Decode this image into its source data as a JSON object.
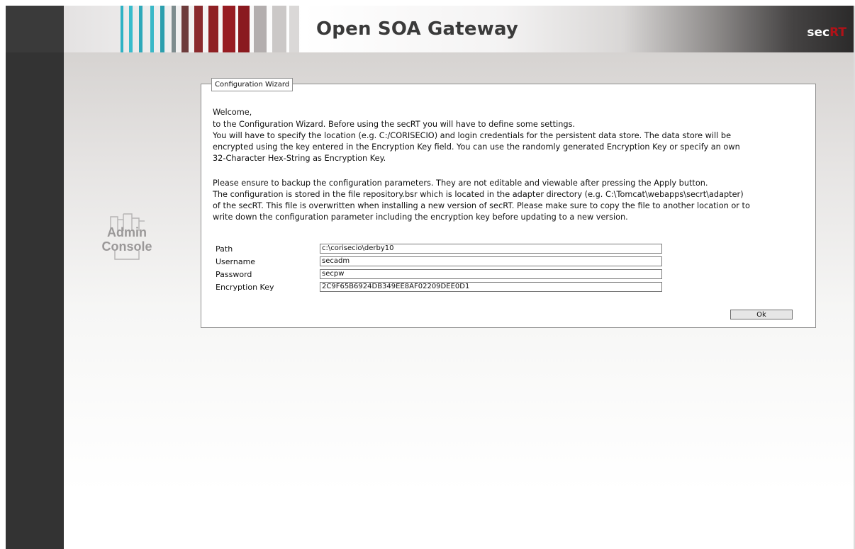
{
  "header": {
    "title": "Open SOA Gateway",
    "brand_prefix": "sec",
    "brand_suffix": "RT",
    "brand_colors": {
      "prefix": "#ffffff",
      "suffix": "#b01218"
    }
  },
  "sidebar": {
    "logo_line1": "Admin",
    "logo_line2": "Console"
  },
  "wizard": {
    "legend": "Configuration Wizard",
    "welcome": "Welcome,",
    "intro": "to the Configuration Wizard. Before using the secRT you will have to define some settings.",
    "para1_line1": "You will have to specify the location (e.g. C:/CORISECIO) and login credentials for the persistent data store. The data store will be",
    "para1_line2": "encrypted using the key entered in the Encryption Key field. You can use the randomly generated Encryption Key or specify an own",
    "para1_line3": "32-Character Hex-String as Encryption Key.",
    "para2_line1": "Please ensure to backup the configuration parameters. They are not editable and viewable after pressing the Apply button.",
    "para2_line2": "The configuration is stored in the file repository.bsr which is located in the adapter directory (e.g. C:\\Tomcat\\webapps\\secrt\\adapter)",
    "para2_line3": "of the secRT. This file is overwritten when installing a new version of secRT. Please make sure to copy the file to another location or to",
    "para2_line4": "write down the configuration parameter including the encryption key before updating to a new version.",
    "fields": [
      {
        "label": "Path",
        "value": "c:\\corisecio\\derby10"
      },
      {
        "label": "Username",
        "value": "secadm"
      },
      {
        "label": "Password",
        "value": "secpw"
      },
      {
        "label": "Encryption Key",
        "value": "2C9F65B6924DB349EE8AF02209DEE0D1"
      }
    ],
    "ok_label": "Ok"
  }
}
